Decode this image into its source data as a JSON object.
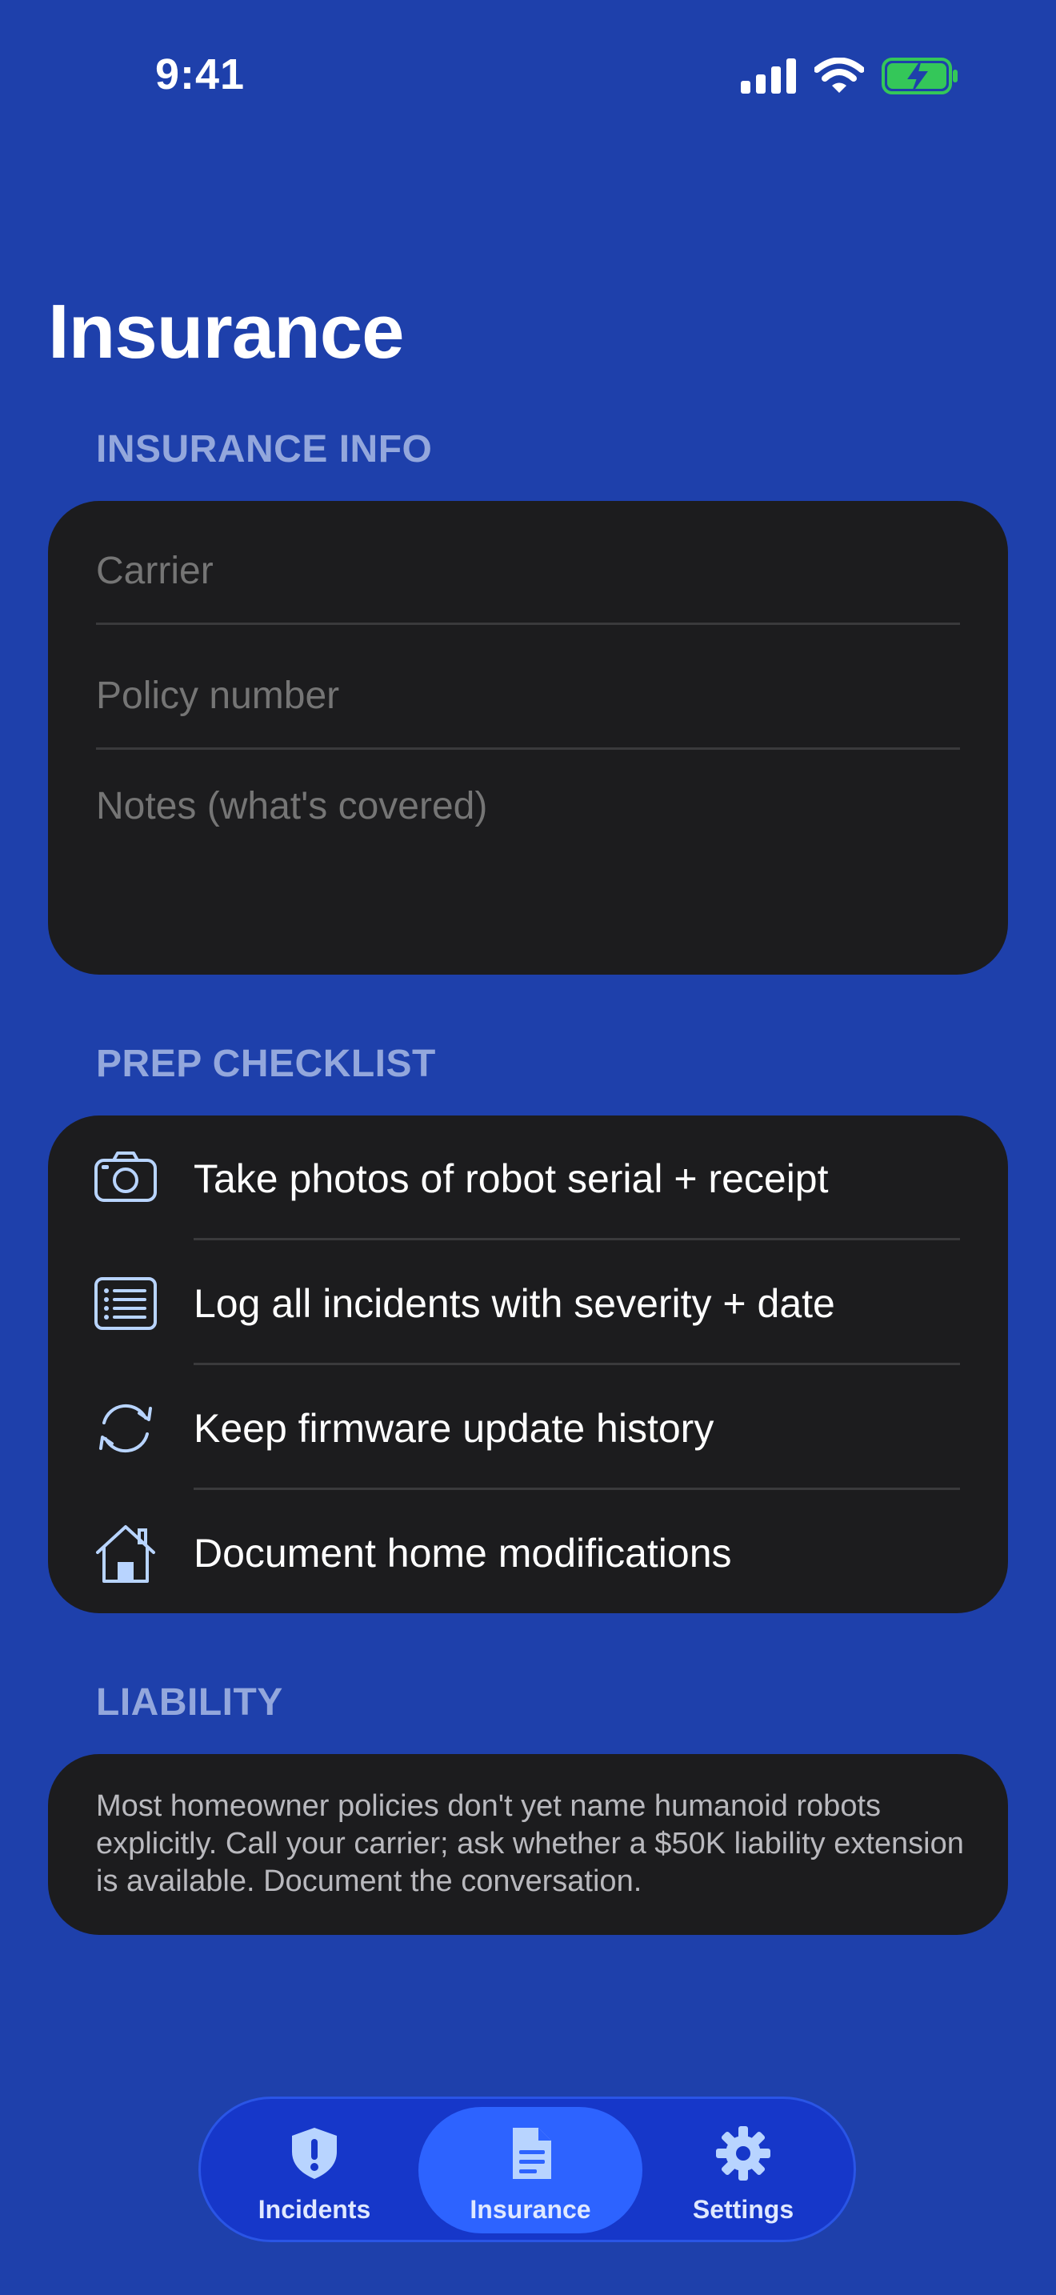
{
  "status_bar": {
    "time": "9:41",
    "icons": [
      "cellular-signal-icon",
      "wifi-icon",
      "battery-charging-icon"
    ],
    "battery_color": "#34c759"
  },
  "page": {
    "title": "Insurance"
  },
  "insurance_info": {
    "header": "INSURANCE INFO",
    "fields": [
      {
        "name": "carrier",
        "value": "",
        "placeholder": "Carrier"
      },
      {
        "name": "policy-number",
        "value": "",
        "placeholder": "Policy number"
      },
      {
        "name": "notes",
        "value": "",
        "placeholder": "Notes (what's covered)"
      }
    ]
  },
  "prep_checklist": {
    "header": "PREP CHECKLIST",
    "items": [
      {
        "icon": "camera-icon",
        "label": "Take photos of robot serial + receipt"
      },
      {
        "icon": "list-icon",
        "label": "Log all incidents with severity + date"
      },
      {
        "icon": "sync-icon",
        "label": "Keep firmware update history"
      },
      {
        "icon": "home-icon",
        "label": "Document home modifications"
      }
    ]
  },
  "liability": {
    "header": "LIABILITY",
    "text": "Most homeowner policies don't yet name humanoid robots explicitly. Call your carrier; ask whether a $50K liability extension is available. Document the conversation."
  },
  "tab_bar": {
    "selected": "Insurance",
    "tabs": [
      {
        "icon": "shield-exclamation-icon",
        "label": "Incidents"
      },
      {
        "icon": "document-icon",
        "label": "Insurance"
      },
      {
        "icon": "gear-icon",
        "label": "Settings"
      }
    ]
  },
  "colors": {
    "background": "#1e40ab",
    "card": "#1c1c1e",
    "section_header": "#93a7dc",
    "checklist_icon": "#b8d4ff",
    "tab_active": "#2d63ff",
    "tab_bar": "#1637c9"
  }
}
